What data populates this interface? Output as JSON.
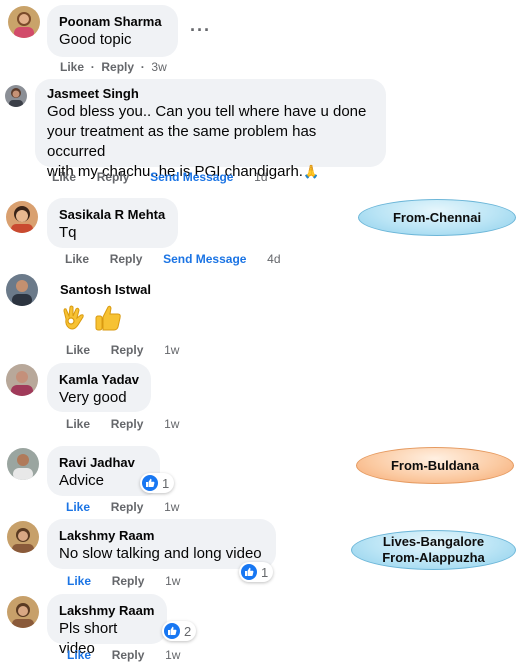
{
  "comments": [
    {
      "author": "Poonam Sharma",
      "text": "Good topic",
      "like": "Like",
      "reply": "Reply",
      "time": "3w",
      "more": "···"
    },
    {
      "author": "Jasmeet Singh",
      "text_lines": [
        "God bless you.. Can you tell where have u done",
        "your treatment as the same problem has occurred",
        "with my chachu..he is PGI chandigarh."
      ],
      "emoji": "🙏",
      "like": "Like",
      "reply": "Reply",
      "send_message": "Send Message",
      "time": "1d"
    },
    {
      "author": "Sasikala R Mehta",
      "text": "Tq",
      "like": "Like",
      "reply": "Reply",
      "send_message": "Send Message",
      "time": "4d"
    },
    {
      "author": "Santosh Istwal",
      "emoji_ok": "ok-hand-emoji",
      "emoji_thumb": "thumbs-up-emoji",
      "like": "Like",
      "reply": "Reply",
      "time": "1w"
    },
    {
      "author": "Kamla Yadav",
      "text": "Very good",
      "like": "Like",
      "reply": "Reply",
      "time": "1w"
    },
    {
      "author": "Ravi Jadhav",
      "text": "Advice",
      "reaction_count": "1",
      "like": "Like",
      "reply": "Reply",
      "time": "1w"
    },
    {
      "author": "Lakshmy Raam",
      "text": "No slow talking and long video",
      "reaction_count": "1",
      "like": "Like",
      "reply": "Reply",
      "time": "1w"
    },
    {
      "author": "Lakshmy Raam",
      "text": "Pls short video",
      "reaction_count": "2",
      "like": "Like",
      "reply": "Reply",
      "time": "1w"
    }
  ],
  "annotations": {
    "chennai": "From-Chennai",
    "buldana": "From-Buldana",
    "bangalore_line1": "Lives-Bangalore",
    "bangalore_line2": "From-Alappuzha"
  },
  "colors": {
    "link_blue": "#1b74e4",
    "bubble": "#f0f2f5",
    "meta_gray": "#65676b",
    "tag_blue": "#b9e4f5",
    "tag_orange": "#fbc9a0"
  }
}
